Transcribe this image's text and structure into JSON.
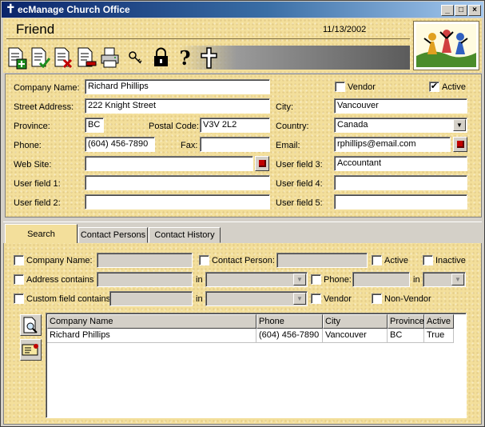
{
  "window": {
    "title": "ecManage Church Office"
  },
  "header": {
    "title": "Friend",
    "date": "11/13/2002"
  },
  "toolbar": {
    "buttons": [
      "new-record",
      "save-record",
      "delete-record",
      "remove-record",
      "print",
      "search",
      "lock",
      "help",
      "church-cross"
    ]
  },
  "form": {
    "company_name": {
      "label": "Company Name:",
      "value": "Richard Phillips"
    },
    "street_address": {
      "label": "Street Address:",
      "value": "222 Knight Street"
    },
    "province": {
      "label": "Province:",
      "value": "BC"
    },
    "postal_code": {
      "label": "Postal Code:",
      "value": "V3V 2L2"
    },
    "phone": {
      "label": "Phone:",
      "value": "(604) 456-7890"
    },
    "fax": {
      "label": "Fax:",
      "value": ""
    },
    "web_site": {
      "label": "Web Site:",
      "value": ""
    },
    "user_field_1": {
      "label": "User field 1:",
      "value": ""
    },
    "user_field_2": {
      "label": "User field 2:",
      "value": ""
    },
    "vendor": {
      "label": "Vendor",
      "checked": false
    },
    "active": {
      "label": "Active",
      "checked": true
    },
    "city": {
      "label": "City:",
      "value": "Vancouver"
    },
    "country": {
      "label": "Country:",
      "value": "Canada"
    },
    "email": {
      "label": "Email:",
      "value": "rphillips@email.com"
    },
    "user_field_3": {
      "label": "User field 3:",
      "value": "Accountant"
    },
    "user_field_4": {
      "label": "User field 4:",
      "value": ""
    },
    "user_field_5": {
      "label": "User field 5:",
      "value": ""
    }
  },
  "tabs": [
    {
      "label": "Search",
      "active": true
    },
    {
      "label": "Contact Persons",
      "active": false
    },
    {
      "label": "Contact History",
      "active": false
    }
  ],
  "search": {
    "company_name_label": "Company Name:",
    "contact_person_label": "Contact Person:",
    "active_label": "Active",
    "inactive_label": "Inactive",
    "address_contains_label": "Address contains",
    "in_label": "in",
    "phone_label": "Phone:",
    "custom_field_label": "Custom field contains",
    "vendor_label": "Vendor",
    "non_vendor_label": "Non-Vendor"
  },
  "results": {
    "columns": [
      "Company Name",
      "Phone",
      "City",
      "Province",
      "Active"
    ],
    "rows": [
      [
        "Richard Phillips",
        "(604) 456-7890",
        "Vancouver",
        "BC",
        "True"
      ]
    ]
  },
  "colors": {
    "title_bar": "#0a246a",
    "parchment": "#f3df9b",
    "accent_red": "#c00000"
  }
}
